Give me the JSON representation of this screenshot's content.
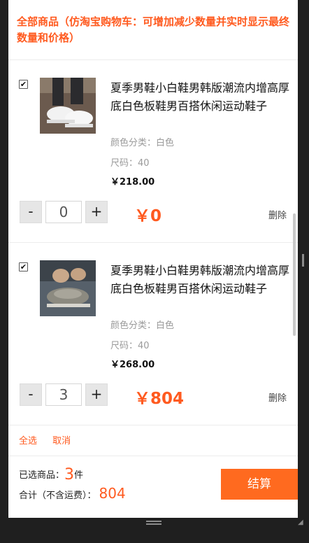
{
  "header": {
    "title": "全部商品（仿淘宝购物车：可增加减少数量并实时显示最终数量和价格）"
  },
  "items": [
    {
      "title": "夏季男鞋小白鞋男韩版潮流内增高厚底白色板鞋男百搭休闲运动鞋子",
      "color": "颜色分类：白色",
      "size": "尺码：40",
      "price": "￥218.00",
      "qty": "0",
      "total": "￥0",
      "minus": "-",
      "plus": "+",
      "delete": "删除",
      "checked": "✔",
      "image": "white-sneaker-photo"
    },
    {
      "title": "夏季男鞋小白鞋男韩版潮流内增高厚底白色板鞋男百搭休闲运动鞋子",
      "color": "颜色分类：白色",
      "size": "尺码：40",
      "price": "￥268.00",
      "qty": "3",
      "total": "￥804",
      "minus": "-",
      "plus": "+",
      "delete": "删除",
      "checked": "✔",
      "image": "grey-sneaker-photo"
    }
  ],
  "footer": {
    "select_all": "全选",
    "cancel": "取消",
    "selected_label": "已选商品：",
    "selected_count": "3",
    "selected_unit": "件",
    "sum_label": "合计（不含运费）：",
    "sum_value": "804",
    "checkout": "结算"
  },
  "colors": {
    "accent": "#ff5a1f",
    "checkout_bg": "#ff6a1f"
  }
}
